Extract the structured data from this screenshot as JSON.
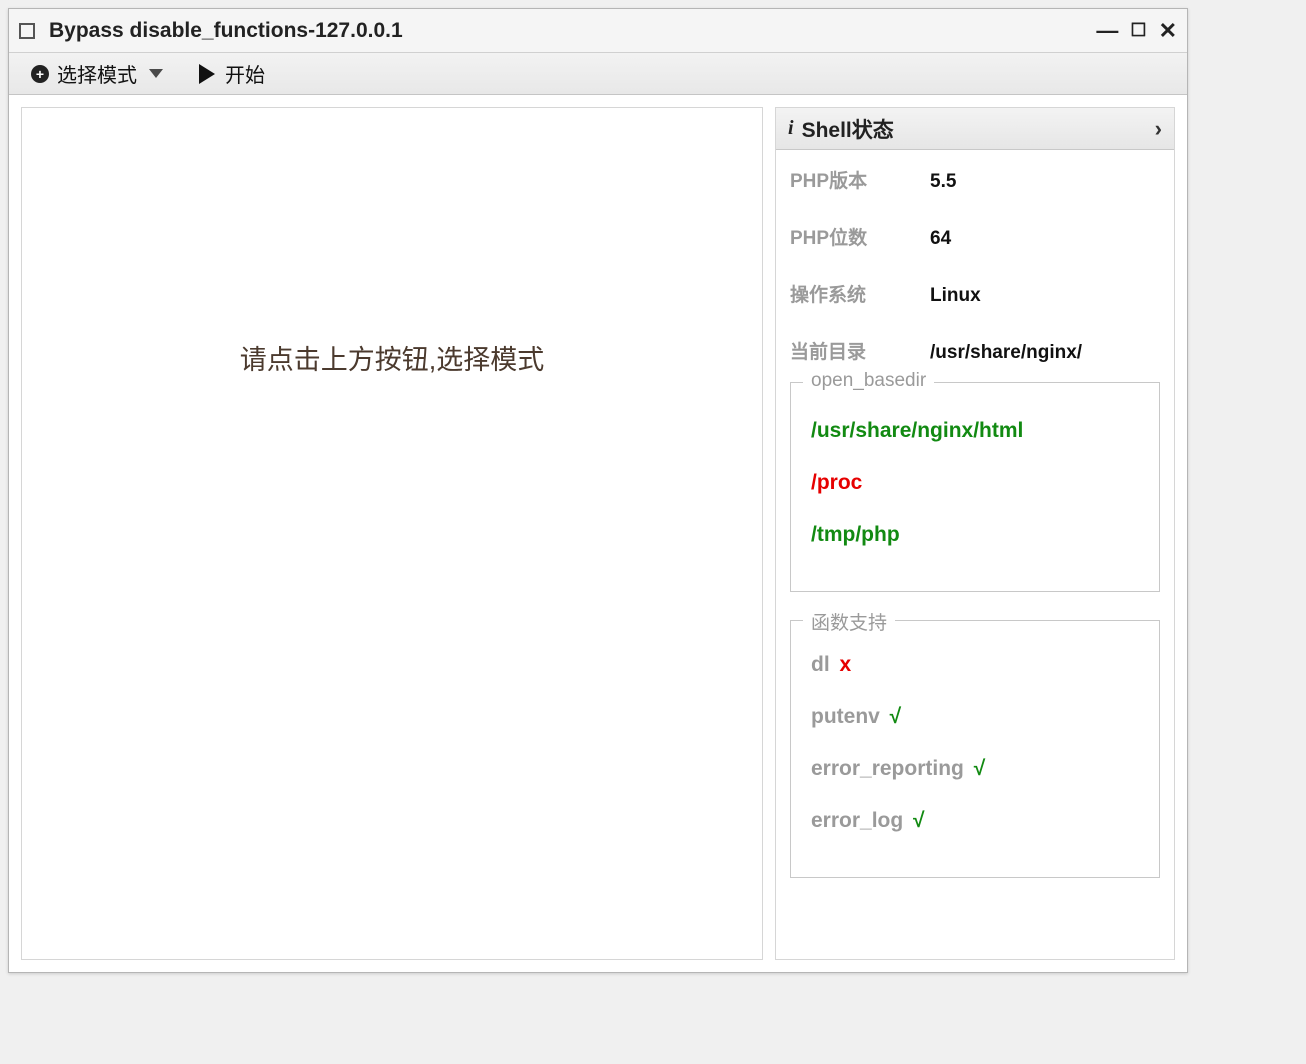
{
  "window": {
    "title": "Bypass disable_functions-127.0.0.1"
  },
  "toolbar": {
    "select_mode": "选择模式",
    "start": "开始"
  },
  "main": {
    "placeholder": "请点击上方按钮,选择模式"
  },
  "panel": {
    "header": "Shell状态",
    "info": {
      "php_version_label": "PHP版本",
      "php_version_value": "5.5",
      "php_bits_label": "PHP位数",
      "php_bits_value": "64",
      "os_label": "操作系统",
      "os_value": "Linux",
      "cwd_label": "当前目录",
      "cwd_value": "/usr/share/nginx/"
    },
    "open_basedir": {
      "legend": "open_basedir",
      "items": [
        {
          "path": "/usr/share/nginx/html",
          "status": "green"
        },
        {
          "path": "/proc",
          "status": "red"
        },
        {
          "path": "/tmp/php",
          "status": "green"
        }
      ]
    },
    "functions": {
      "legend": "函数支持",
      "items": [
        {
          "name": "dl",
          "supported": false
        },
        {
          "name": "putenv",
          "supported": true
        },
        {
          "name": "error_reporting",
          "supported": true
        },
        {
          "name": "error_log",
          "supported": true
        }
      ]
    }
  },
  "marks": {
    "yes": "√",
    "no": "x"
  }
}
